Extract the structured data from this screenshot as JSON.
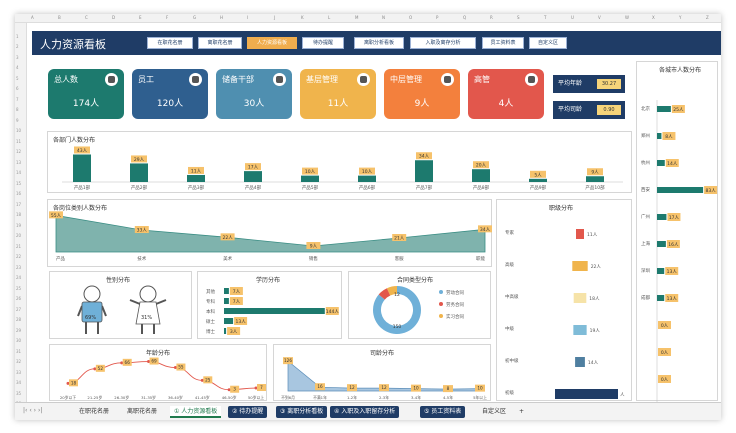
{
  "app_title": "人力资源看板",
  "nav": [
    "在职花名册",
    "离职花名册",
    "人力资源看板",
    "待办提醒",
    "离职分析看板",
    "入职及离存分析",
    "员工资料表",
    "自定义区"
  ],
  "nav_active": 2,
  "cards": [
    {
      "label": "总人数",
      "value": "174人",
      "color": "#1d7a6e"
    },
    {
      "label": "员工",
      "value": "120人",
      "color": "#2f5f8f"
    },
    {
      "label": "储备干部",
      "value": "30人",
      "color": "#4f8fb0"
    },
    {
      "label": "基层管理",
      "value": "11人",
      "color": "#f0b44c"
    },
    {
      "label": "中层管理",
      "value": "9人",
      "color": "#f3803d"
    },
    {
      "label": "高管",
      "value": "4人",
      "color": "#e2574c"
    }
  ],
  "avg": [
    {
      "label": "平均年龄",
      "value": "30.27"
    },
    {
      "label": "平均司龄",
      "value": "0.90"
    }
  ],
  "dept_chart": {
    "title": "各部门人数分布",
    "categories": [
      "产品1部",
      "产品2部",
      "产品3部",
      "产品4部",
      "产品5部",
      "产品6部",
      "产品7部",
      "产品8部",
      "产品9部",
      "产品10部"
    ],
    "values": [
      43,
      29,
      11,
      17,
      10,
      10,
      34,
      20,
      5,
      9
    ],
    "labels": [
      "43人",
      "29人",
      "11人",
      "17人",
      "10人",
      "10人",
      "34人",
      "20人",
      "5人",
      "9人"
    ]
  },
  "job_chart": {
    "title": "各岗位类别人数分布",
    "categories": [
      "产品",
      "技术",
      "美术",
      "销售",
      "客服",
      "职能"
    ],
    "values": [
      55,
      33,
      22,
      9,
      21,
      34
    ],
    "labels": [
      "55人",
      "33人",
      "22人",
      "9人",
      "21人",
      "34人"
    ]
  },
  "level_chart": {
    "title": "职级分布",
    "categories": [
      "专家",
      "高级",
      "中高级",
      "中级",
      "初中级",
      "初级"
    ],
    "values": [
      11,
      22,
      18,
      19,
      14,
      90
    ],
    "labels": [
      "11人",
      "22人",
      "18人",
      "19人",
      "14人",
      "人"
    ],
    "colors": [
      "#e2574c",
      "#f0b44c",
      "#f6e3a8",
      "#7fbcd8",
      "#4f7fa0",
      "#1f3c66"
    ]
  },
  "city_chart": {
    "title": "各城市人数分布",
    "categories": [
      "北京",
      "郑州",
      "杭州",
      "西安",
      "广州",
      "上海",
      "深圳",
      "成都",
      "",
      "",
      ""
    ],
    "values": [
      25,
      8,
      14,
      83,
      17,
      16,
      13,
      13,
      0,
      0,
      0
    ],
    "labels": [
      "25人",
      "8人",
      "14人",
      "83人",
      "17人",
      "16人",
      "13人",
      "13人",
      "0人",
      "0人",
      "0人"
    ]
  },
  "gender": {
    "title": "性别分布",
    "male": "69%",
    "female": "31%"
  },
  "edu_chart": {
    "title": "学历分布",
    "categories": [
      "其他",
      "专科",
      "本科",
      "硕士",
      "博士"
    ],
    "values": [
      7,
      7,
      144,
      13,
      3
    ],
    "labels": [
      "7人",
      "7人",
      "144人",
      "13人",
      "3人"
    ]
  },
  "contract": {
    "title": "合同类型分布",
    "legend": [
      "劳动合同",
      "劳务合同",
      "实习合同"
    ],
    "values": [
      150,
      12,
      12
    ],
    "colors": [
      "#6fb0d8",
      "#e2574c",
      "#f0b44c"
    ]
  },
  "age_chart": {
    "title": "年龄分布",
    "categories": [
      "20岁以下",
      "21-25岁",
      "26-30岁",
      "31-35岁",
      "36-40岁",
      "41-45岁",
      "46-50岁",
      "50岁以上"
    ],
    "values": [
      18,
      52,
      66,
      69,
      55,
      25,
      3,
      7
    ],
    "labels": [
      "18",
      "52",
      "66",
      "69",
      "55",
      "25",
      "3",
      "7"
    ]
  },
  "tenure_chart": {
    "title": "司龄分布",
    "categories": [
      "不到6月",
      "不满1年",
      "1-2年",
      "2-3年",
      "3-4年",
      "4-5年",
      "5年以上"
    ],
    "values": [
      126,
      16,
      12,
      12,
      10,
      8,
      10
    ],
    "labels": [
      "126",
      "16",
      "12",
      "12",
      "10",
      "8",
      "10"
    ]
  },
  "tabs": [
    "在职花名册",
    "离职花名册",
    "① 人力资源看板",
    "② 待办提醒",
    "③ 离职分析看板",
    "④ 入职及入职留存分析",
    "⑤ 员工资料表",
    "自定义区"
  ],
  "tab_selected": 2
}
